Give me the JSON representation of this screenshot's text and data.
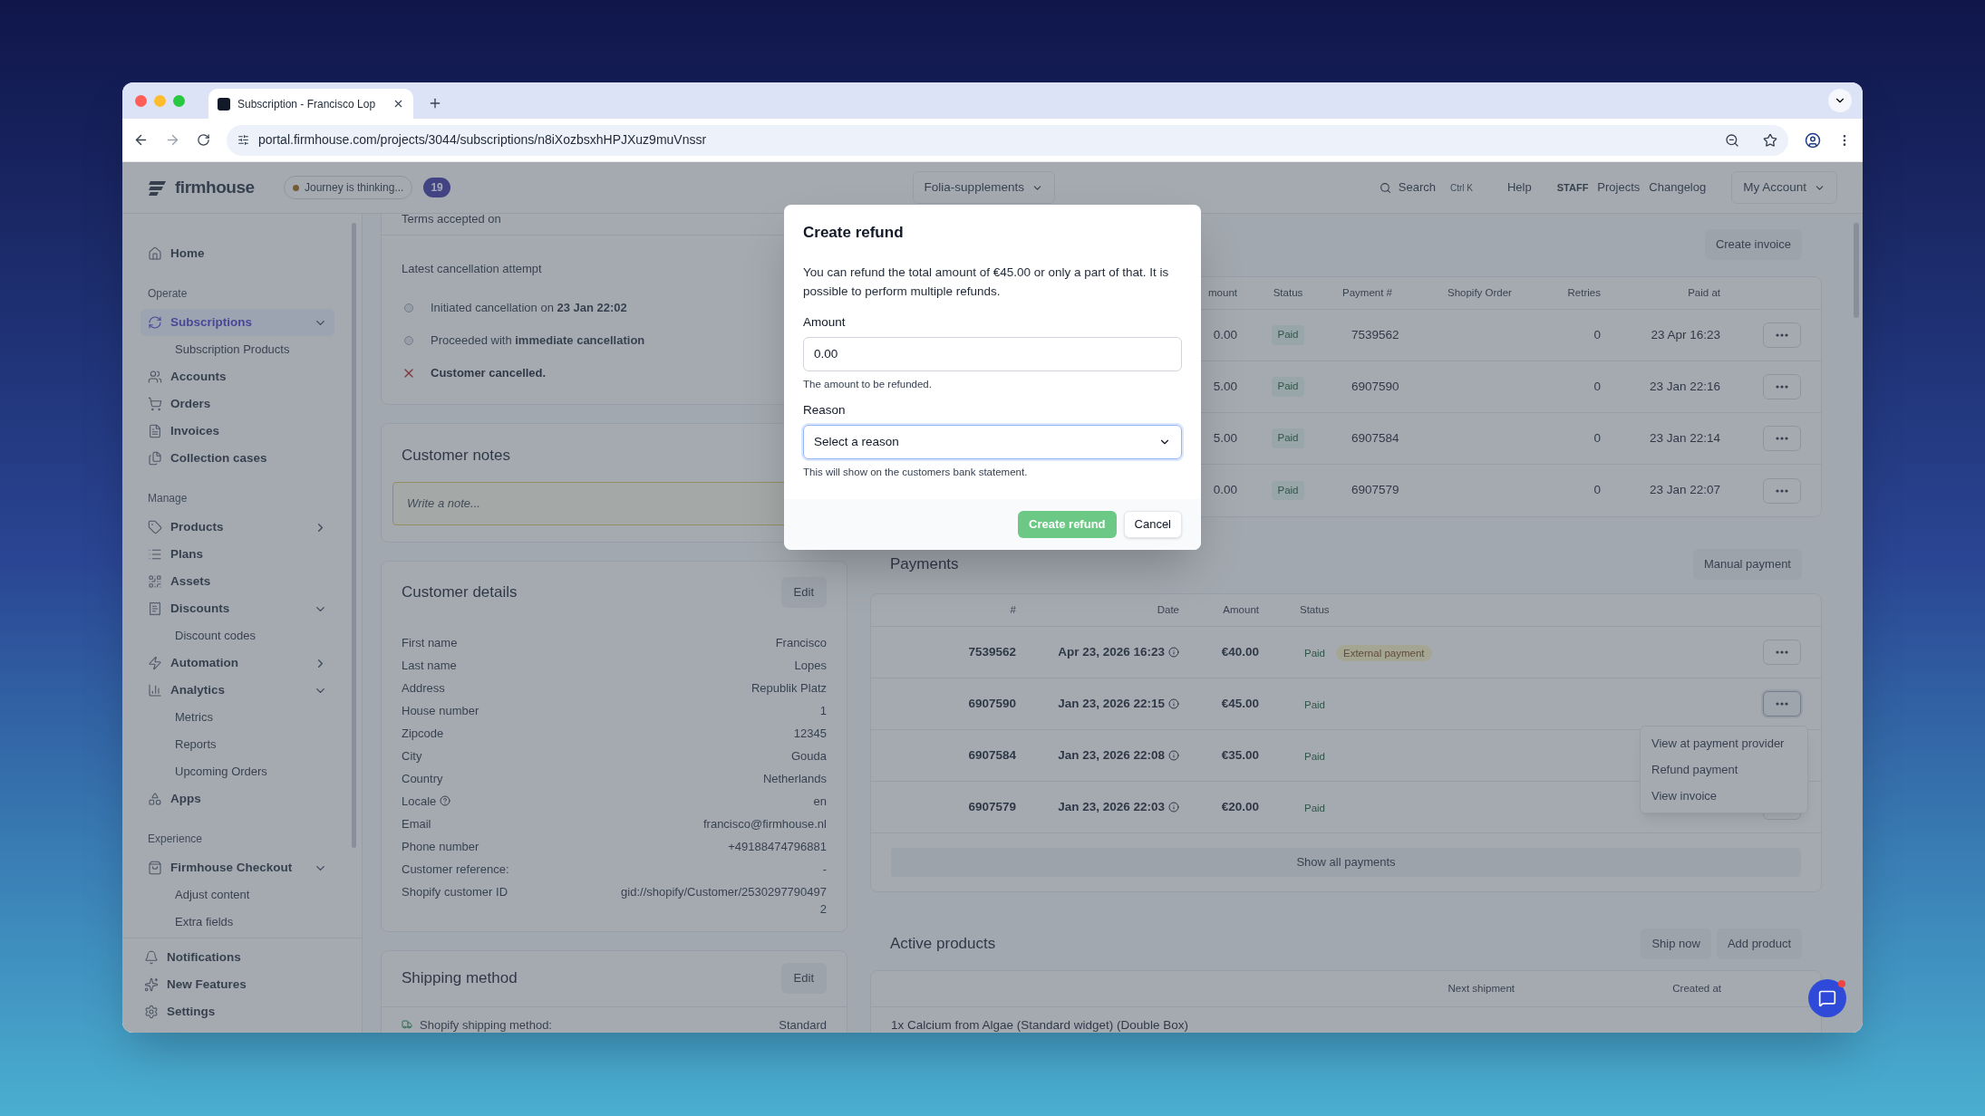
{
  "browser": {
    "tab_title": "Subscription - Francisco Lop",
    "url": "portal.firmhouse.com/projects/3044/subscriptions/n8iXozbsxhHPJXuz9muVnssr"
  },
  "header": {
    "logo": "firmhouse",
    "journey": "Journey is thinking...",
    "journey_count": "19",
    "project": "Folia-supplements",
    "search": {
      "placeholder": "Search",
      "shortcut": "Ctrl K"
    },
    "links": [
      {
        "label": "Help",
        "kind": "link"
      },
      {
        "label": "STAFF",
        "kind": "tag"
      },
      {
        "label": "Projects",
        "kind": "link"
      },
      {
        "label": "Changelog",
        "kind": "link"
      }
    ],
    "account": "My Account"
  },
  "sidebar": {
    "sections": [
      {
        "items": [
          {
            "label": "Home",
            "selected": false
          }
        ]
      },
      {
        "title": "Operate",
        "items": [
          {
            "label": "Subscriptions",
            "selected": true,
            "expanded": true,
            "children": [
              {
                "label": "Subscription Products",
                "selected": false
              }
            ]
          },
          {
            "label": "Accounts",
            "selected": false
          },
          {
            "label": "Orders",
            "selected": false
          },
          {
            "label": "Invoices",
            "selected": false
          },
          {
            "label": "Collection cases",
            "selected": false
          }
        ]
      },
      {
        "title": "Manage",
        "items": [
          {
            "label": "Products",
            "selected": false,
            "expanded": false
          },
          {
            "label": "Plans",
            "selected": false
          },
          {
            "label": "Assets",
            "selected": false
          },
          {
            "label": "Discounts",
            "selected": false,
            "expanded": true,
            "children": [
              {
                "label": "Discount codes",
                "selected": false
              }
            ]
          },
          {
            "label": "Automation",
            "selected": false,
            "expanded": false
          },
          {
            "label": "Analytics",
            "selected": false,
            "expanded": true,
            "children": [
              {
                "label": "Metrics",
                "selected": false
              },
              {
                "label": "Reports",
                "selected": false
              },
              {
                "label": "Upcoming Orders",
                "selected": false
              }
            ]
          },
          {
            "label": "Apps",
            "selected": false
          }
        ]
      },
      {
        "title": "Experience",
        "items": [
          {
            "label": "Firmhouse Checkout",
            "selected": false,
            "expanded": true,
            "children": [
              {
                "label": "Adjust content",
                "selected": false
              },
              {
                "label": "Extra fields",
                "selected": false
              }
            ]
          }
        ]
      }
    ],
    "footer": [
      {
        "label": "Notifications",
        "selected": false
      },
      {
        "label": "New Features",
        "selected": false
      },
      {
        "label": "Settings",
        "selected": false
      }
    ]
  },
  "terms": {
    "label": "Terms accepted on"
  },
  "cancellation": {
    "title": "Latest cancellation attempt",
    "steps": [
      {
        "kind": "step",
        "text": "Initiated cancellation on **23 Jan 22:02**"
      },
      {
        "kind": "step",
        "text": "Proceeded with **immediate cancellation**"
      },
      {
        "kind": "cancelled",
        "text": "Customer cancelled."
      }
    ]
  },
  "notes": {
    "title": "Customer notes",
    "placeholder": "Write a note..."
  },
  "customer_details": {
    "title": "Customer details",
    "edit": "Edit",
    "rows": [
      {
        "label": "First name",
        "value": "Francisco",
        "help": false
      },
      {
        "label": "Last name",
        "value": "Lopes",
        "help": false
      },
      {
        "label": "Address",
        "value": "Republik Platz",
        "help": false
      },
      {
        "label": "House number",
        "value": "1",
        "help": false
      },
      {
        "label": "Zipcode",
        "value": "12345",
        "help": false
      },
      {
        "label": "City",
        "value": "Gouda",
        "help": false
      },
      {
        "label": "Country",
        "value": "Netherlands",
        "help": false
      },
      {
        "label": "Locale",
        "value": "en",
        "help": true
      },
      {
        "label": "Email",
        "value": "francisco@firmhouse.nl",
        "help": false
      },
      {
        "label": "Phone number",
        "value": "+49188474796881",
        "help": false
      },
      {
        "label": "Customer reference:",
        "value": "-",
        "help": false
      },
      {
        "label": "Shopify customer ID",
        "value": "gid://shopify/Customer/25302977904972",
        "help": false
      }
    ]
  },
  "shipping": {
    "title": "Shipping method",
    "edit": "Edit",
    "row": {
      "label": "Shopify shipping method:",
      "value": "Standard"
    }
  },
  "invoices": {
    "button": "Create invoice",
    "columns": [
      "mount",
      "Status",
      "Payment #",
      "Shopify Order",
      "Retries",
      "Paid at"
    ],
    "rows": [
      {
        "amount": "0.00",
        "status": "Paid",
        "payment": "7539562",
        "retries": "0",
        "paid_at": "23 Apr 16:23"
      },
      {
        "amount": "5.00",
        "status": "Paid",
        "payment": "6907590",
        "retries": "0",
        "paid_at": "23 Jan 22:16"
      },
      {
        "amount": "5.00",
        "status": "Paid",
        "payment": "6907584",
        "retries": "0",
        "paid_at": "23 Jan 22:14"
      },
      {
        "amount": "0.00",
        "status": "Paid",
        "payment": "6907579",
        "retries": "0",
        "paid_at": "23 Jan 22:07"
      }
    ]
  },
  "payments": {
    "title": "Payments",
    "button": "Manual payment",
    "columns": [
      "#",
      "Date",
      "Amount",
      "Status"
    ],
    "rows": [
      {
        "number": "7539562",
        "date": "Apr 23, 2026 16:23",
        "amount": "€40.00",
        "status": "Paid",
        "badge": "External payment",
        "menu_open": false
      },
      {
        "number": "6907590",
        "date": "Jan 23, 2026 22:15",
        "amount": "€45.00",
        "status": "Paid",
        "menu_open": true
      },
      {
        "number": "6907584",
        "date": "Jan 23, 2026 22:08",
        "amount": "€35.00",
        "status": "Paid",
        "menu_open": false
      },
      {
        "number": "6907579",
        "date": "Jan 23, 2026 22:03",
        "amount": "€20.00",
        "status": "Paid",
        "menu_open": false
      }
    ],
    "show_all": "Show all payments",
    "menu": [
      "View at payment provider",
      "Refund payment",
      "View invoice"
    ]
  },
  "active_products": {
    "title": "Active products",
    "buttons": [
      "Ship now",
      "Add product"
    ],
    "columns": [
      "Next shipment",
      "Created at"
    ],
    "rows": [
      {
        "product": "1x Calcium from Algae (Standard widget) (Double Box)"
      }
    ]
  },
  "modal": {
    "title": "Create refund",
    "description": "You can refund the total amount of €45.00 or only a part of that. It is possible to perform multiple refunds.",
    "amount": {
      "label": "Amount",
      "value": "0.00",
      "help": "The amount to be refunded."
    },
    "reason": {
      "label": "Reason",
      "placeholder": "Select a reason",
      "help": "This will show on the customers bank statement.",
      "focused": true
    },
    "buttons": [
      {
        "label": "Create refund",
        "kind": "primary",
        "disabled": true
      },
      {
        "label": "Cancel",
        "kind": "secondary",
        "disabled": false
      }
    ]
  },
  "chat": {
    "unread": true
  }
}
